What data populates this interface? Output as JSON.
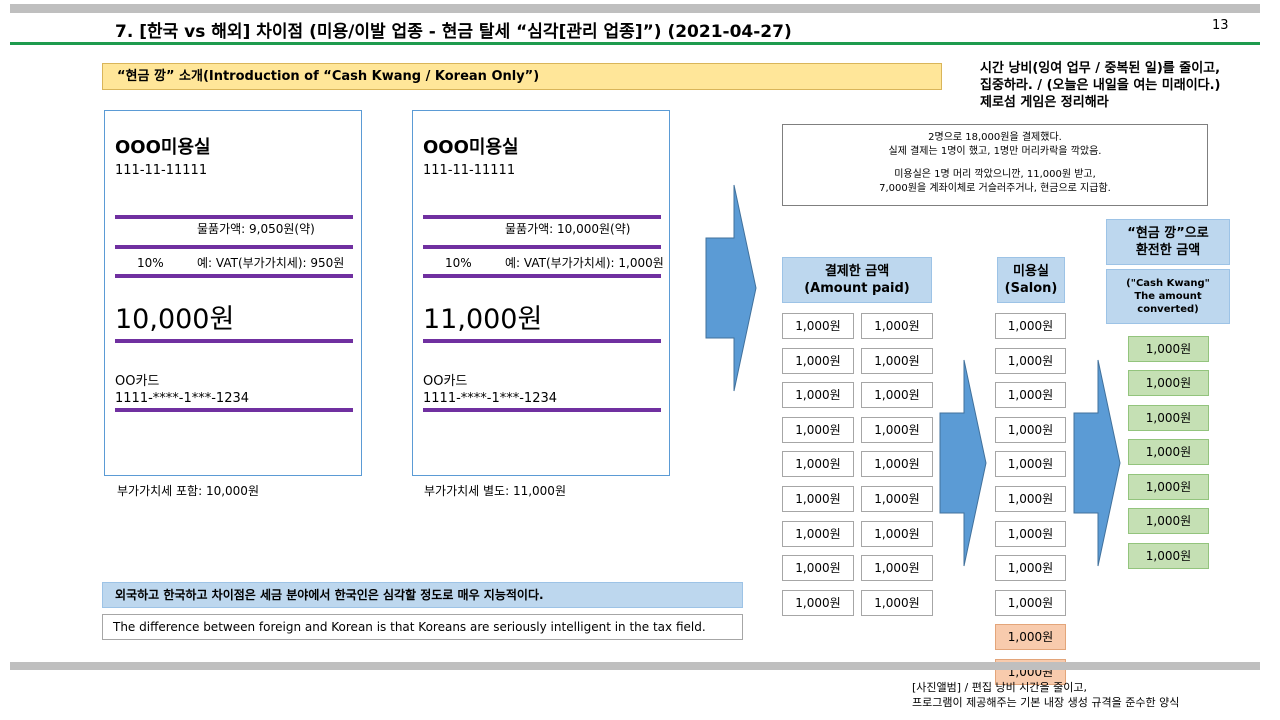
{
  "slide": {
    "title": "7. [한국 vs 해외] 차이점 (미용/이발 업종 - 현금 탈세 “심각[관리 업종]”) (2021-04-27)",
    "page_number": "13",
    "intro_label": "“현금 깡” 소개(Introduction of “Cash Kwang / Korean Only”)",
    "note": {
      "line1": "시간 낭비(잉여 업무 / 중복된 일)를 줄이고,",
      "line2": "집중하라. / (오늘은 내일을 여는 미래이다.)",
      "line3": "제로섬 게임은 정리해라"
    }
  },
  "receipts": [
    {
      "shop": "OOO미용실",
      "biz_no": "111-11-11111",
      "price_label": "물품가액: 9,050원(약)",
      "vat_rate": "10%",
      "vat_label": "예: VAT(부가가치세): 950원",
      "total": "10,000원",
      "card_name": "OO카드",
      "card_no": "1111-****-1***-1234",
      "caption": "부가가치세 포함: 10,000원"
    },
    {
      "shop": "OOO미용실",
      "biz_no": "111-11-11111",
      "price_label": "물품가액: 10,000원(약)",
      "vat_rate": "10%",
      "vat_label": "예: VAT(부가가치세): 1,000원",
      "total": "11,000원",
      "card_name": "OO카드",
      "card_no": "1111-****-1***-1234",
      "caption": "부가가치세 별도: 11,000원"
    }
  ],
  "explanation": {
    "line1": "2명으로 18,000원을 결제했다.",
    "line2": "실제 결제는 1명이 했고, 1명만 머리카락을 깍았음.",
    "line3": "미용실은 1명 머리 깍았으니깐, 11,000원 받고,",
    "line4": "7,000원을 계좌이체로 거슬러주거나, 현금으로 지급함."
  },
  "flow": {
    "paid_header": {
      "line1": "결제한 금액",
      "line2": "(Amount paid)"
    },
    "salon_header": {
      "line1": "미용실",
      "line2": "(Salon)"
    },
    "converted_header": {
      "line1": "“현금 깡”으로",
      "line2": "환전한 금액"
    },
    "converted_sub": {
      "line1": "(\"Cash Kwang\"",
      "line2": "The amount",
      "line3": "converted)"
    },
    "paid_amounts": [
      "1,000원",
      "1,000원",
      "1,000원",
      "1,000원",
      "1,000원",
      "1,000원",
      "1,000원",
      "1,000원",
      "1,000원",
      "1,000원",
      "1,000원",
      "1,000원",
      "1,000원",
      "1,000원",
      "1,000원",
      "1,000원",
      "1,000원",
      "1,000원"
    ],
    "salon_amounts": [
      "1,000원",
      "1,000원",
      "1,000원",
      "1,000원",
      "1,000원",
      "1,000원",
      "1,000원",
      "1,000원",
      "1,000원",
      "1,000원",
      "1,000원"
    ],
    "converted_amounts": [
      "1,000원",
      "1,000원",
      "1,000원",
      "1,000원",
      "1,000원",
      "1,000원",
      "1,000원"
    ],
    "colors": {
      "arrow": "#5b9bd5",
      "orange": "#f8cbad",
      "green": "#c5e0b4",
      "header": "#bdd7ee"
    }
  },
  "summary": {
    "korean": "외국하고 한국하고 차이점은 세금 분야에서 한국인은 심각할 정도로 매우 지능적이다.",
    "english": "The difference between foreign and Korean is that Koreans are seriously intelligent in the tax field."
  },
  "bottom_note": {
    "line1": "[사진앨범] / 편집 낭비 시간을 줄이고,",
    "line2": "프로그램이 제공해주는 기본 내장 생성 규격을 준수한 양식"
  }
}
